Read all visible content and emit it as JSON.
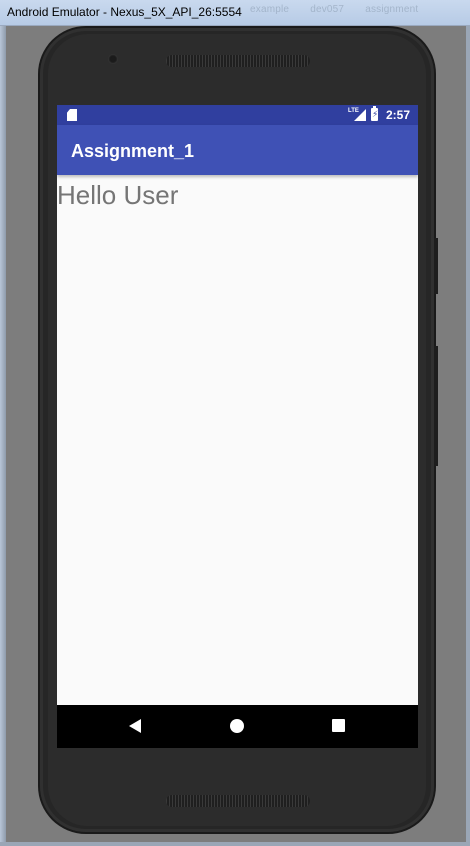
{
  "window": {
    "title": "Android Emulator - Nexus_5X_API_26:5554",
    "background_tabs": [
      "example",
      "dev057",
      "assignment"
    ]
  },
  "status_bar": {
    "time": "2:57",
    "network": "LTE",
    "color": "#303f9f"
  },
  "app_bar": {
    "title": "Assignment_1",
    "color": "#3f51b5"
  },
  "content": {
    "greeting": "Hello User"
  },
  "nav_bar": {
    "back_icon": "back-triangle",
    "home_icon": "home-circle",
    "recents_icon": "recents-square"
  }
}
